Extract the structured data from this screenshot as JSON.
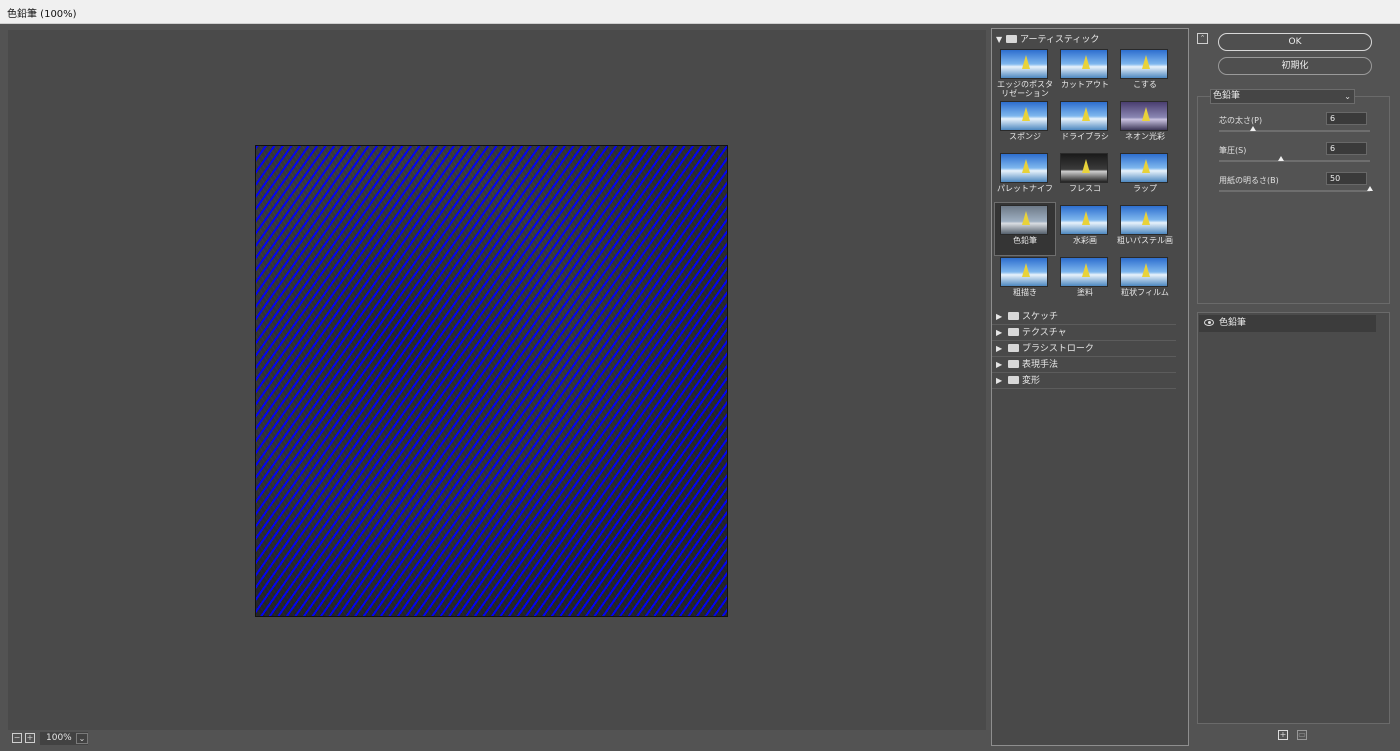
{
  "window": {
    "title": "色鉛筆 (100%)"
  },
  "preview": {
    "zoom": "100%",
    "zoom_out": "−",
    "zoom_in": "+"
  },
  "gallery": {
    "expanded_category": "アーティスティック",
    "filters": [
      {
        "label": "エッジのポスタリゼーション",
        "style": "normal"
      },
      {
        "label": "カットアウト",
        "style": "normal"
      },
      {
        "label": "こする",
        "style": "normal"
      },
      {
        "label": "スポンジ",
        "style": "normal"
      },
      {
        "label": "ドライブラシ",
        "style": "normal"
      },
      {
        "label": "ネオン光彩",
        "style": "neon"
      },
      {
        "label": "パレットナイフ",
        "style": "normal"
      },
      {
        "label": "フレスコ",
        "style": "dark"
      },
      {
        "label": "ラップ",
        "style": "normal"
      },
      {
        "label": "色鉛筆",
        "style": "gray",
        "selected": true
      },
      {
        "label": "水彩画",
        "style": "normal"
      },
      {
        "label": "粗いパステル画",
        "style": "normal"
      },
      {
        "label": "粗描き",
        "style": "normal"
      },
      {
        "label": "塗料",
        "style": "normal"
      },
      {
        "label": "粒状フィルム",
        "style": "normal"
      }
    ],
    "collapsed_categories": [
      "スケッチ",
      "テクスチャ",
      "ブラシストローク",
      "表現手法",
      "変形"
    ]
  },
  "buttons": {
    "ok": "OK",
    "reset": "初期化"
  },
  "settings": {
    "selected_filter": "色鉛筆",
    "params": [
      {
        "label": "芯の太さ(P)",
        "value": "6",
        "fraction": 0.21
      },
      {
        "label": "筆圧(S)",
        "value": "6",
        "fraction": 0.4
      },
      {
        "label": "用紙の明るさ(B)",
        "value": "50",
        "fraction": 1.0
      }
    ]
  },
  "layers": {
    "items": [
      {
        "name": "色鉛筆"
      }
    ]
  },
  "icons": {
    "new_layer": "new-effect-layer-icon",
    "delete": "trash-icon"
  }
}
